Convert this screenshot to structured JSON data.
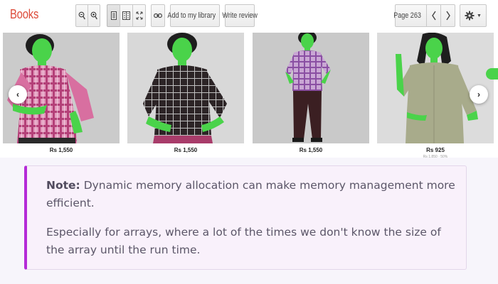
{
  "toolbar": {
    "brand": "Books",
    "add_library_label": "Add to my library",
    "write_review_label": "Write review",
    "page_label": "Page 263",
    "icons": [
      "zoom-out-icon",
      "zoom-in-icon",
      "single-page-icon",
      "two-page-icon",
      "fullscreen-icon",
      "link-icon",
      "prev-page-icon",
      "next-page-icon",
      "gear-icon"
    ]
  },
  "products": [
    {
      "price": "Rs 1,550",
      "shirt": "pink plaid",
      "bg": "#cfcfcf"
    },
    {
      "price": "Rs 1,550",
      "shirt": "black plaid",
      "bg": "#d9d9d9"
    },
    {
      "price": "Rs 1,550",
      "shirt": "lavender plaid",
      "bg": "#cdcdcd"
    },
    {
      "price": "Rs 925",
      "subprice": "Rs 1,850 · 50%",
      "shirt": "sage",
      "bg": "#dcdcdc"
    }
  ],
  "carousel": {
    "prev_icon": "chevron-left-icon",
    "next_icon": "chevron-right-icon"
  },
  "note": {
    "label": "Note:",
    "text1": "Dynamic memory allocation can make memory management more efficient.",
    "text2": "Especially for arrays, where a lot of the times we don't know the size of the array until the run time."
  },
  "colors": {
    "brand": "#dd4b39",
    "note_accent": "#b42bd7",
    "note_bg": "#f9f1fb",
    "skin_overlay": "#4ad34a"
  }
}
